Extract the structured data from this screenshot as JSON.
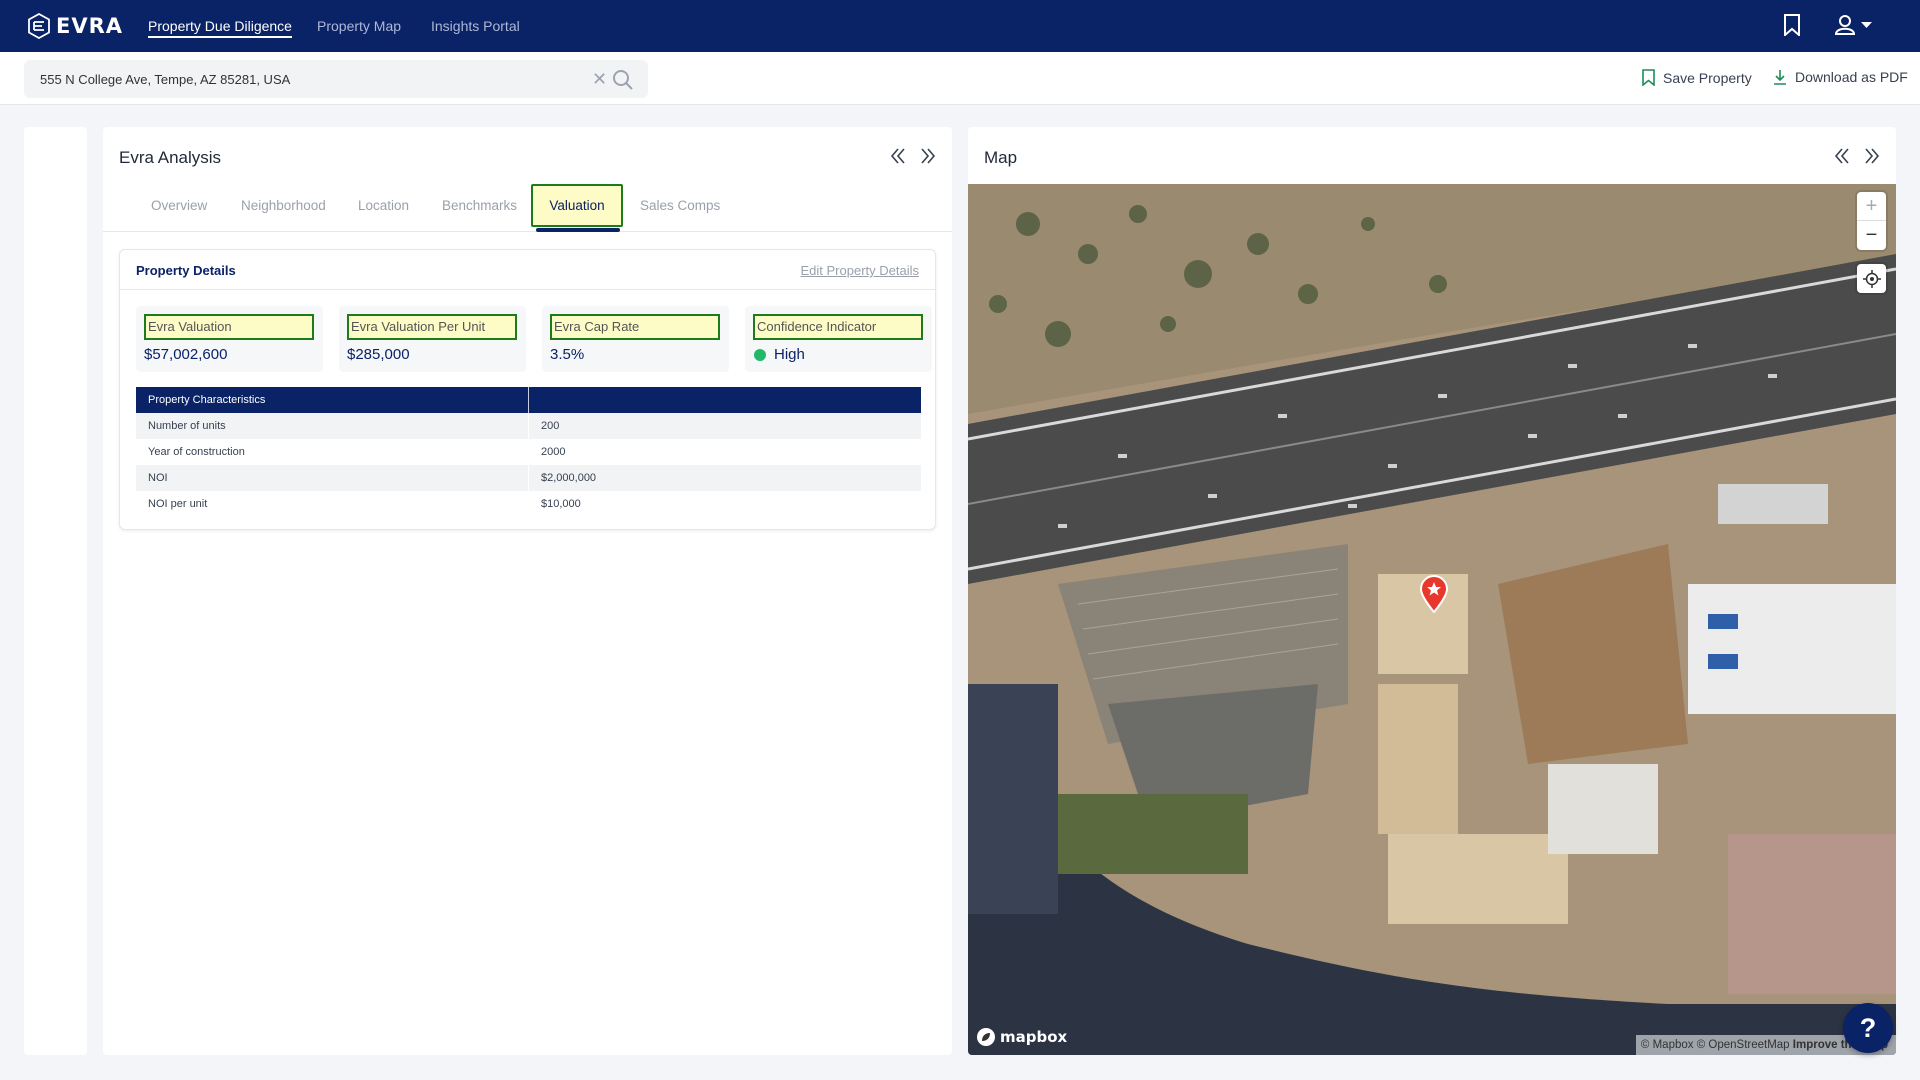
{
  "brand": {
    "name": "EVRA"
  },
  "nav": {
    "links": [
      "Property Due Diligence",
      "Property Map",
      "Insights Portal"
    ]
  },
  "search": {
    "value": "555 N College Ave, Tempe, AZ 85281, USA"
  },
  "actions": {
    "save": "Save Property",
    "download": "Download as PDF"
  },
  "analysis": {
    "title": "Evra Analysis",
    "tabs": [
      "Overview",
      "Neighborhood",
      "Location",
      "Benchmarks",
      "Valuation",
      "Sales Comps"
    ],
    "active_tab": "Valuation"
  },
  "details": {
    "title": "Property Details",
    "edit_label": "Edit Property Details",
    "metrics": [
      {
        "label": "Evra Valuation",
        "value": "$57,002,600"
      },
      {
        "label": "Evra Valuation Per Unit",
        "value": "$285,000"
      },
      {
        "label": "Evra Cap Rate",
        "value": "3.5%"
      },
      {
        "label": "Confidence Indicator",
        "value": "High"
      }
    ],
    "table_header": "Property Characteristics",
    "rows": [
      {
        "label": "Number of units",
        "value": "200"
      },
      {
        "label": "Year of construction",
        "value": "2000"
      },
      {
        "label": "NOI",
        "value": "$2,000,000"
      },
      {
        "label": "NOI per unit",
        "value": "$10,000"
      }
    ]
  },
  "map": {
    "title": "Map",
    "zoom_in": "+",
    "zoom_out": "−",
    "logo": "mapbox",
    "attribution": {
      "mapbox": "© Mapbox",
      "osm": "© OpenStreetMap",
      "improve": "Improve this map"
    }
  },
  "help": {
    "label": "?"
  },
  "colors": {
    "navy": "#0a2266",
    "highlight": "#fdfbc6",
    "highlight_border": "#1c7c1c",
    "confidence_high": "#22b86a",
    "pin": "#e8382b"
  }
}
